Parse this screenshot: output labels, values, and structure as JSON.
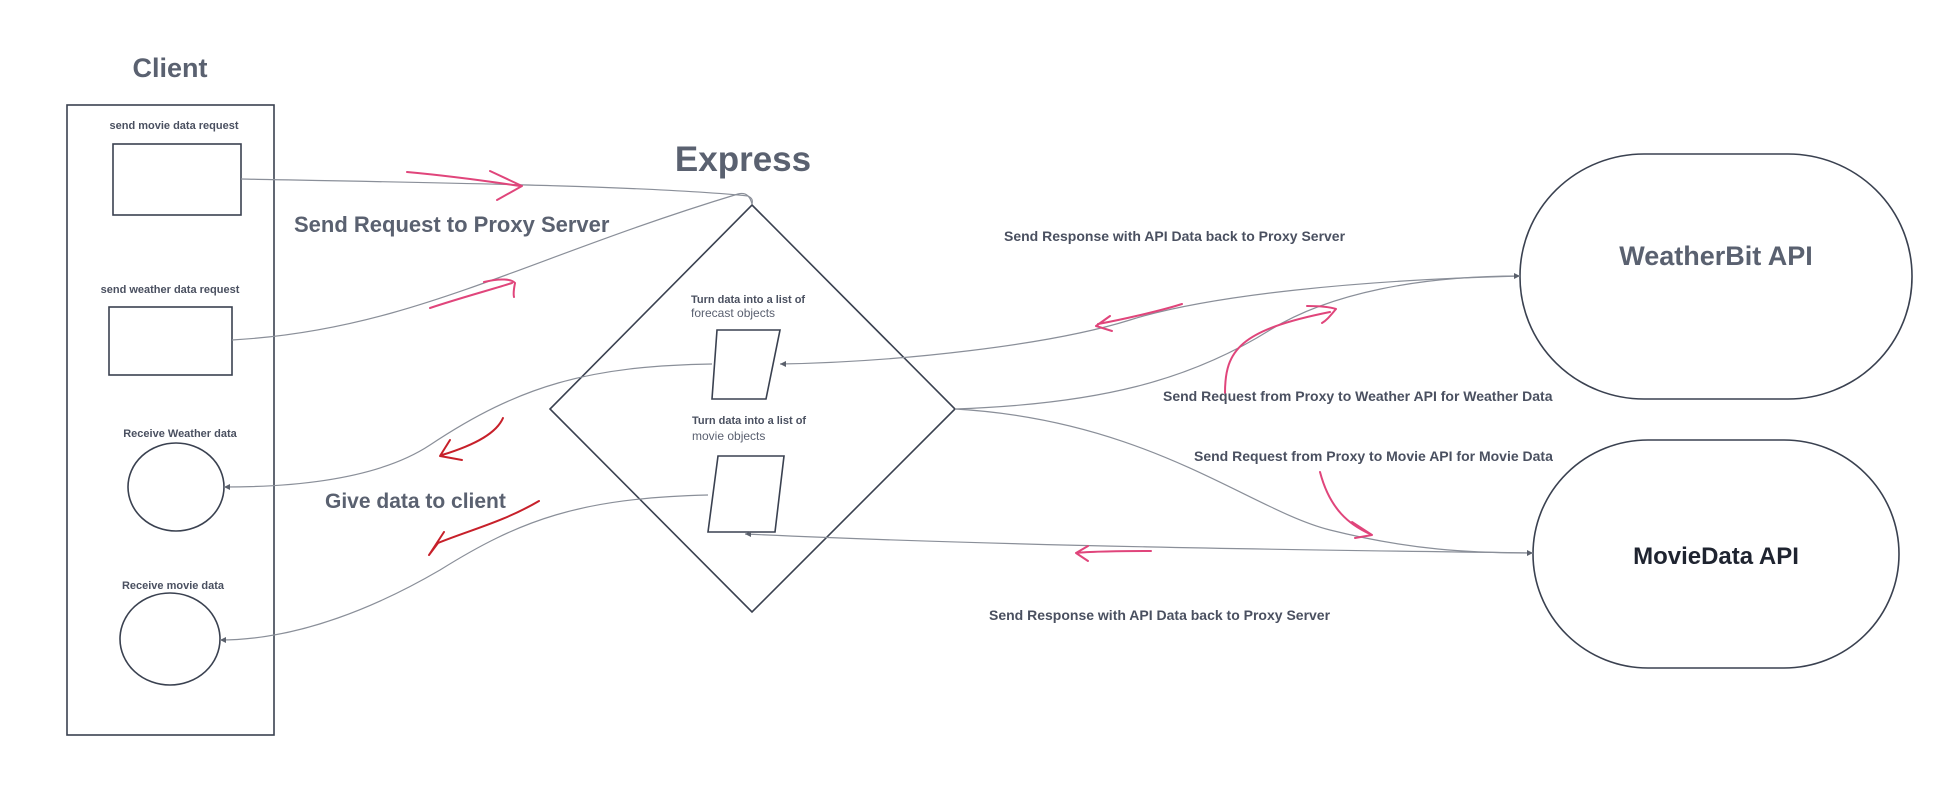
{
  "client": {
    "title": "Client",
    "send_movie_label": "send movie data request",
    "send_weather_label": "send weather data request",
    "receive_weather_label": "Receive Weather data",
    "receive_movie_label": "Receive movie data"
  },
  "express": {
    "title": "Express",
    "forecast_note_line1": "Turn data into a list of",
    "forecast_note_line2": "forecast objects",
    "movie_note_line1": "Turn data into a list of",
    "movie_note_line2": "movie objects"
  },
  "apis": {
    "weather": "WeatherBit API",
    "movie": "MovieData API"
  },
  "labels": {
    "send_request_proxy": "Send Request to Proxy Server",
    "give_data_client": "Give data to client",
    "weather_response": "Send Response with API Data back to Proxy Server",
    "weather_request": "Send Request from Proxy to Weather API for Weather Data",
    "movie_request": "Send Request from Proxy to Movie API for Movie Data",
    "movie_response": "Send Response with API Data back to Proxy Server"
  },
  "colors": {
    "shape_stroke": "#3a4150",
    "connector": "#8a8f99",
    "sketch_pink": "#e0457b",
    "sketch_red": "#c7202a"
  }
}
